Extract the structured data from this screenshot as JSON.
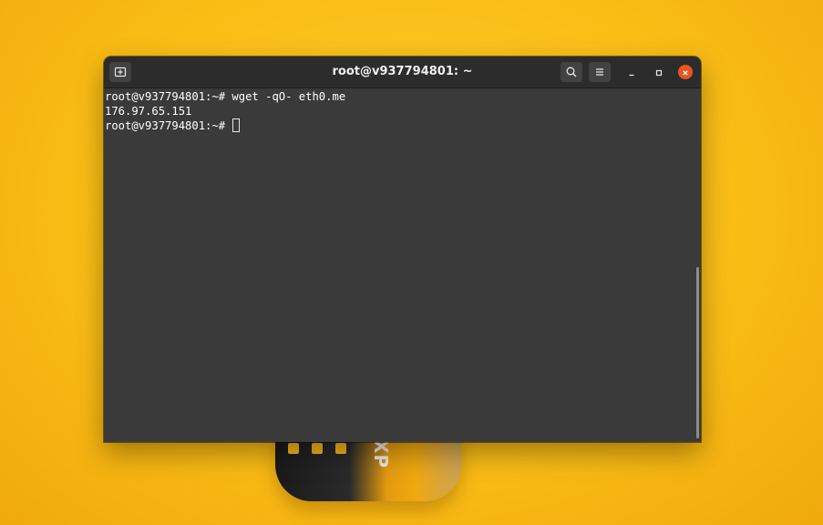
{
  "window": {
    "title": "root@v937794801: ~"
  },
  "terminal": {
    "lines": [
      {
        "prompt": "root@v937794801:~# ",
        "text": "wget -qO- eth0.me"
      },
      {
        "prompt": "",
        "text": "176.97.65.151"
      },
      {
        "prompt": "root@v937794801:~# ",
        "text": ""
      }
    ]
  },
  "background": {
    "canister_text": "XP"
  },
  "icons": {
    "new_tab": "new-tab-icon",
    "search": "search-icon",
    "menu": "hamburger-menu-icon",
    "minimize": "minimize-icon",
    "maximize": "maximize-icon",
    "close": "close-icon"
  },
  "colors": {
    "accent_close": "#e95420",
    "terminal_bg": "#3a3a3a",
    "titlebar_bg": "#2c2c2c",
    "desktop_bg": "#f9bd16"
  }
}
